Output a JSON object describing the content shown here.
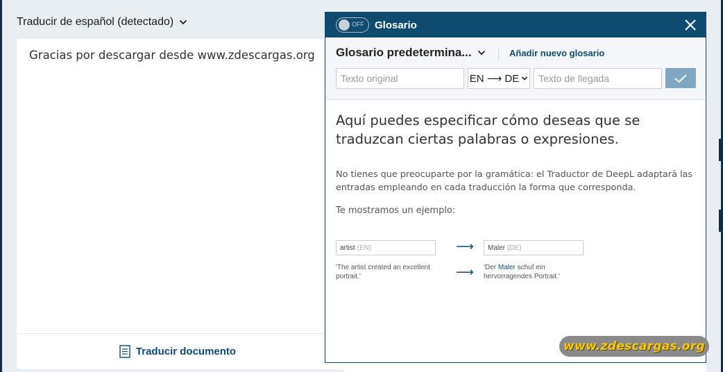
{
  "source": {
    "language_label": "Traducir de español (detectado)",
    "text": "Gracias por descargar desde www.zdescargas.org",
    "translate_document_label": "Traducir documento"
  },
  "glossary": {
    "toggle_label": "OFF",
    "title": "Glosario",
    "selected_glossary": "Glosario predetermina...",
    "add_glossary_label": "Añadir nuevo glosario",
    "original_placeholder": "Texto original",
    "language_pair": "EN ⟶ DE",
    "target_placeholder": "Texto de llegada",
    "heading": "Aquí puedes especificar cómo deseas que se traduzcan ciertas palabras o expresiones.",
    "paragraph": "No tienes que preocuparte por la gramática: el Traductor de DeepL adaptará las entradas empleando en cada traducción la forma que corresponda.",
    "example_label": "Te mostramos un ejemplo:",
    "example": {
      "source_term": "artist",
      "source_lang": "(EN)",
      "target_term": "Maler",
      "target_lang": "(DE)",
      "source_sentence": "'The artist created an excellent portrait.'",
      "target_sentence_before": "'Der ",
      "target_sentence_highlight": "Maler",
      "target_sentence_after": " schuf ein hervorragendes Portrait.'"
    }
  },
  "watermark": "www.zdescargas.org",
  "colors": {
    "accent": "#0f4b6e",
    "confirm_button": "#7fa7c2",
    "watermark_text": "#f5c518"
  }
}
